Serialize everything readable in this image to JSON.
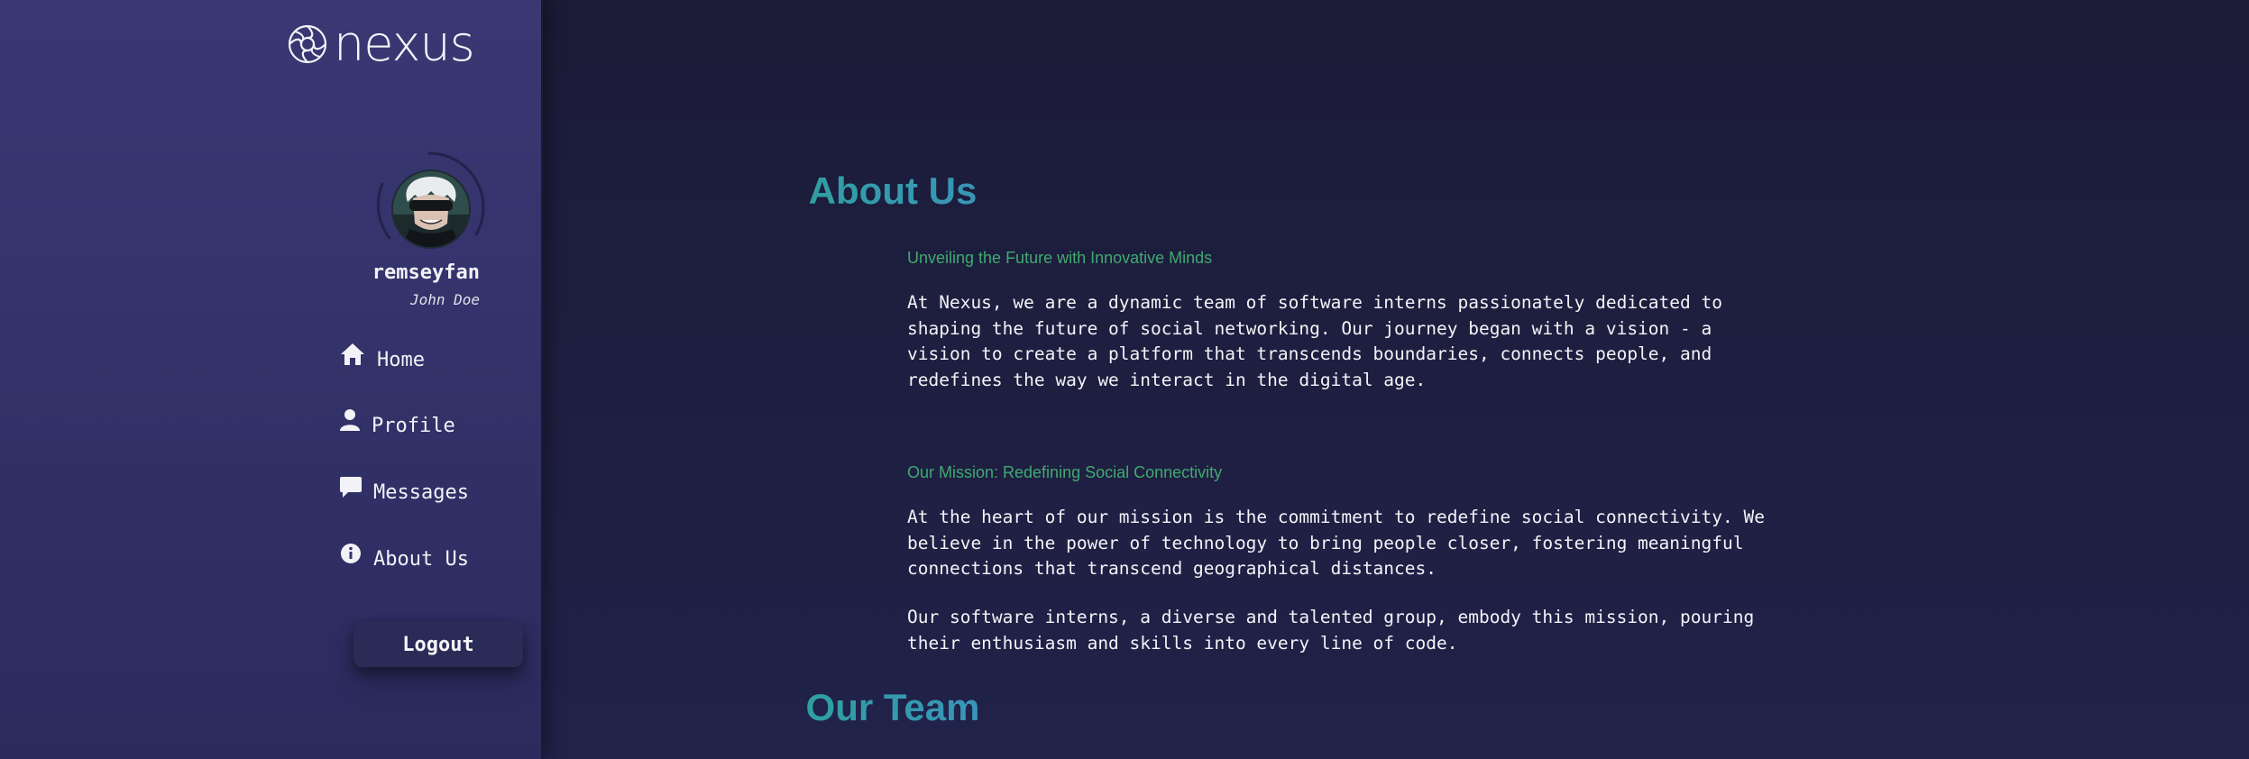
{
  "app": {
    "logo_text": "nexus"
  },
  "user": {
    "username": "remseyfan",
    "full_name": "John Doe"
  },
  "nav": {
    "items": [
      {
        "label": "Home",
        "icon": "home-icon"
      },
      {
        "label": "Profile",
        "icon": "user-icon"
      },
      {
        "label": "Messages",
        "icon": "chat-bubble-icon"
      },
      {
        "label": "About Us",
        "icon": "info-icon"
      }
    ],
    "logout_label": "Logout"
  },
  "content": {
    "title": "About Us",
    "sections": [
      {
        "subtitle": "Unveiling the Future with Innovative Minds",
        "paragraphs": [
          "At Nexus, we are a dynamic team of software interns passionately dedicated to shaping the future of social networking. Our journey began with a vision - a vision to create a platform that transcends boundaries, connects people, and redefines the way we interact in the digital age."
        ]
      },
      {
        "subtitle": "Our Mission: Redefining Social Connectivity",
        "paragraphs": [
          "At the heart of our mission is the commitment to redefine social connectivity. We believe in the power of technology to bring people closer, fostering meaningful connections that transcend geographical distances.",
          "Our software interns, a diverse and talented group, embody this mission, pouring their enthusiasm and skills into every line of code."
        ]
      }
    ],
    "team_title": "Our Team"
  },
  "colors": {
    "sidebar_bg": "#37356e",
    "main_bg": "#1d1d3b",
    "heading_gradient_start": "#2aa597",
    "heading_gradient_end": "#3f8fc4",
    "subheading": "#3eaa6f",
    "text": "#f3f3f7"
  }
}
